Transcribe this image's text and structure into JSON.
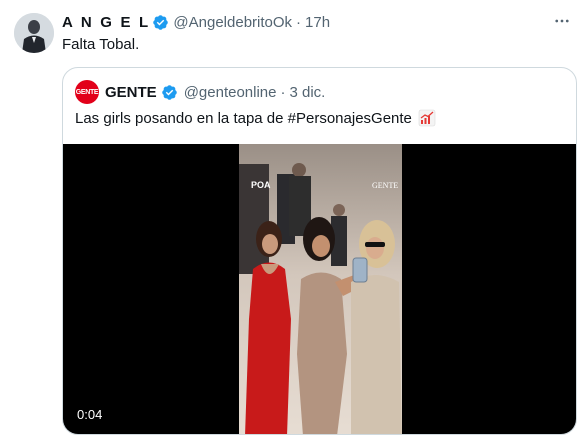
{
  "tweet": {
    "name": "A N G E L",
    "handle": "@AngeldebritoOk",
    "separator": "·",
    "time": "17h",
    "text": "Falta Tobal.",
    "more_icon": "more-horizontal-icon"
  },
  "quote": {
    "avatar_text": "GENTE",
    "name": "GENTE",
    "handle": "@genteonline",
    "separator": "·",
    "time": "3 dic.",
    "text": "Las girls posando en la tapa de #PersonajesGente",
    "emoji": "chart-increasing-emoji",
    "video": {
      "duration": "0:04",
      "watermark_left": "POA",
      "watermark_right": "GENTE"
    }
  },
  "colors": {
    "verified": "#1d9bf0",
    "secondary_text": "#536471",
    "border": "#cfd9de",
    "gente_red": "#e2001a"
  }
}
